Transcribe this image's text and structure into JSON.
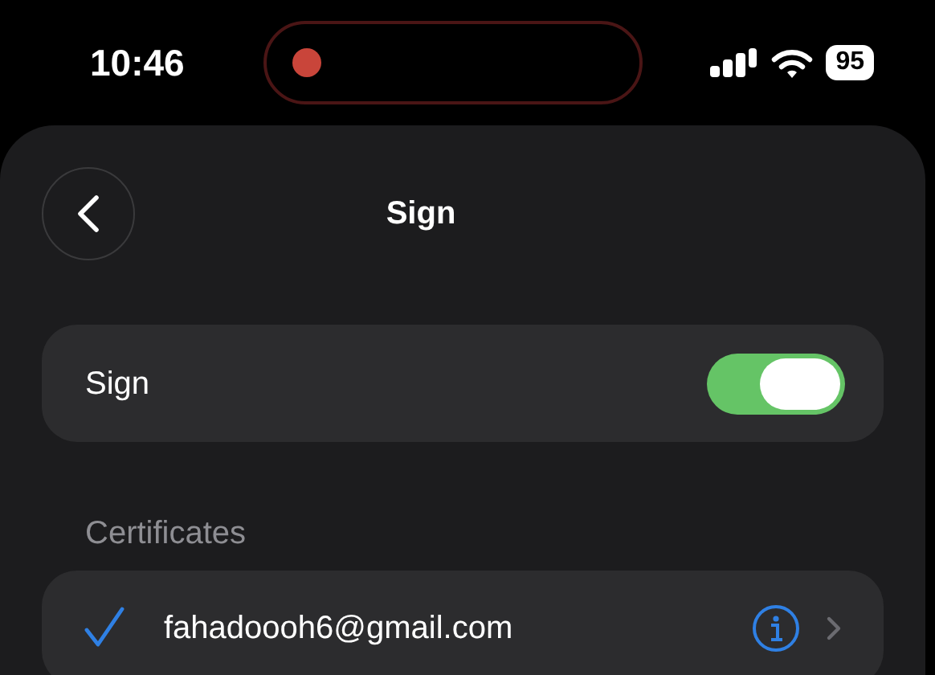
{
  "status_bar": {
    "time": "10:46",
    "battery": "95",
    "recording": true
  },
  "nav": {
    "title": "Sign"
  },
  "sign_toggle": {
    "label": "Sign",
    "on": true
  },
  "certificates": {
    "header": "Certificates",
    "items": [
      {
        "email": "fahadoooh6@gmail.com",
        "selected": true
      }
    ]
  }
}
